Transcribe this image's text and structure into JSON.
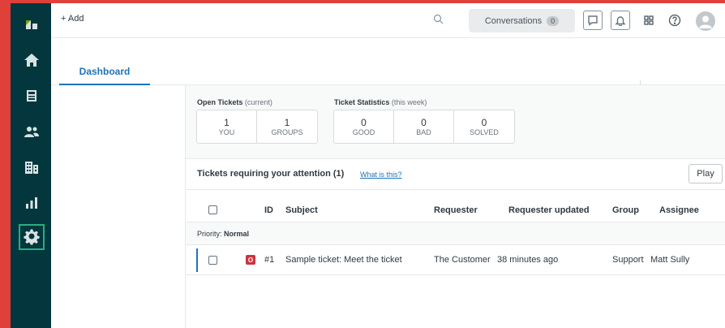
{
  "topbar": {
    "add_label": "+ Add",
    "conversations_label": "Conversations",
    "conversations_count": "0"
  },
  "tabs": {
    "dashboard": "Dashboard"
  },
  "stats": {
    "open_title": "Open Tickets",
    "open_sub": "(current)",
    "open_cells": [
      {
        "num": "1",
        "label": "YOU"
      },
      {
        "num": "1",
        "label": "GROUPS"
      }
    ],
    "week_title": "Ticket Statistics",
    "week_sub": "(this week)",
    "week_cells": [
      {
        "num": "0",
        "label": "GOOD"
      },
      {
        "num": "0",
        "label": "BAD"
      },
      {
        "num": "0",
        "label": "SOLVED"
      }
    ]
  },
  "attention": {
    "title": "Tickets requiring your attention (1)",
    "link": "What is this?",
    "play_label": "Play"
  },
  "table": {
    "columns": [
      "ID",
      "Subject",
      "Requester",
      "Requester updated",
      "Group",
      "Assignee"
    ],
    "group_prefix": "Priority:",
    "group_value": "Normal",
    "rows": [
      {
        "status": "O",
        "id": "#1",
        "subject": "Sample ticket: Meet the ticket",
        "requester": "The Customer",
        "updated": "38 minutes ago",
        "group": "Support",
        "assignee": "Matt Sully"
      }
    ]
  },
  "colors": {
    "sidebar": "#03363d",
    "accent_blue": "#1f73b7",
    "active_green": "#26b07f",
    "status_open": "#cc3340"
  }
}
